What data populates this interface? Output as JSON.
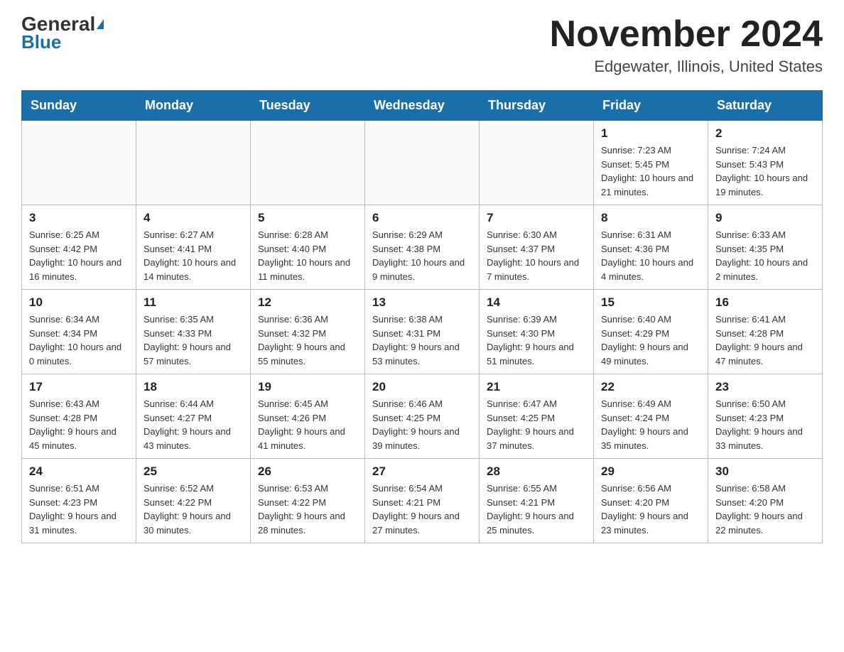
{
  "header": {
    "logo_general": "General",
    "logo_blue": "Blue",
    "month_title": "November 2024",
    "location": "Edgewater, Illinois, United States"
  },
  "days_of_week": [
    "Sunday",
    "Monday",
    "Tuesday",
    "Wednesday",
    "Thursday",
    "Friday",
    "Saturday"
  ],
  "weeks": [
    [
      {
        "day": "",
        "info": ""
      },
      {
        "day": "",
        "info": ""
      },
      {
        "day": "",
        "info": ""
      },
      {
        "day": "",
        "info": ""
      },
      {
        "day": "",
        "info": ""
      },
      {
        "day": "1",
        "info": "Sunrise: 7:23 AM\nSunset: 5:45 PM\nDaylight: 10 hours and 21 minutes."
      },
      {
        "day": "2",
        "info": "Sunrise: 7:24 AM\nSunset: 5:43 PM\nDaylight: 10 hours and 19 minutes."
      }
    ],
    [
      {
        "day": "3",
        "info": "Sunrise: 6:25 AM\nSunset: 4:42 PM\nDaylight: 10 hours and 16 minutes."
      },
      {
        "day": "4",
        "info": "Sunrise: 6:27 AM\nSunset: 4:41 PM\nDaylight: 10 hours and 14 minutes."
      },
      {
        "day": "5",
        "info": "Sunrise: 6:28 AM\nSunset: 4:40 PM\nDaylight: 10 hours and 11 minutes."
      },
      {
        "day": "6",
        "info": "Sunrise: 6:29 AM\nSunset: 4:38 PM\nDaylight: 10 hours and 9 minutes."
      },
      {
        "day": "7",
        "info": "Sunrise: 6:30 AM\nSunset: 4:37 PM\nDaylight: 10 hours and 7 minutes."
      },
      {
        "day": "8",
        "info": "Sunrise: 6:31 AM\nSunset: 4:36 PM\nDaylight: 10 hours and 4 minutes."
      },
      {
        "day": "9",
        "info": "Sunrise: 6:33 AM\nSunset: 4:35 PM\nDaylight: 10 hours and 2 minutes."
      }
    ],
    [
      {
        "day": "10",
        "info": "Sunrise: 6:34 AM\nSunset: 4:34 PM\nDaylight: 10 hours and 0 minutes."
      },
      {
        "day": "11",
        "info": "Sunrise: 6:35 AM\nSunset: 4:33 PM\nDaylight: 9 hours and 57 minutes."
      },
      {
        "day": "12",
        "info": "Sunrise: 6:36 AM\nSunset: 4:32 PM\nDaylight: 9 hours and 55 minutes."
      },
      {
        "day": "13",
        "info": "Sunrise: 6:38 AM\nSunset: 4:31 PM\nDaylight: 9 hours and 53 minutes."
      },
      {
        "day": "14",
        "info": "Sunrise: 6:39 AM\nSunset: 4:30 PM\nDaylight: 9 hours and 51 minutes."
      },
      {
        "day": "15",
        "info": "Sunrise: 6:40 AM\nSunset: 4:29 PM\nDaylight: 9 hours and 49 minutes."
      },
      {
        "day": "16",
        "info": "Sunrise: 6:41 AM\nSunset: 4:28 PM\nDaylight: 9 hours and 47 minutes."
      }
    ],
    [
      {
        "day": "17",
        "info": "Sunrise: 6:43 AM\nSunset: 4:28 PM\nDaylight: 9 hours and 45 minutes."
      },
      {
        "day": "18",
        "info": "Sunrise: 6:44 AM\nSunset: 4:27 PM\nDaylight: 9 hours and 43 minutes."
      },
      {
        "day": "19",
        "info": "Sunrise: 6:45 AM\nSunset: 4:26 PM\nDaylight: 9 hours and 41 minutes."
      },
      {
        "day": "20",
        "info": "Sunrise: 6:46 AM\nSunset: 4:25 PM\nDaylight: 9 hours and 39 minutes."
      },
      {
        "day": "21",
        "info": "Sunrise: 6:47 AM\nSunset: 4:25 PM\nDaylight: 9 hours and 37 minutes."
      },
      {
        "day": "22",
        "info": "Sunrise: 6:49 AM\nSunset: 4:24 PM\nDaylight: 9 hours and 35 minutes."
      },
      {
        "day": "23",
        "info": "Sunrise: 6:50 AM\nSunset: 4:23 PM\nDaylight: 9 hours and 33 minutes."
      }
    ],
    [
      {
        "day": "24",
        "info": "Sunrise: 6:51 AM\nSunset: 4:23 PM\nDaylight: 9 hours and 31 minutes."
      },
      {
        "day": "25",
        "info": "Sunrise: 6:52 AM\nSunset: 4:22 PM\nDaylight: 9 hours and 30 minutes."
      },
      {
        "day": "26",
        "info": "Sunrise: 6:53 AM\nSunset: 4:22 PM\nDaylight: 9 hours and 28 minutes."
      },
      {
        "day": "27",
        "info": "Sunrise: 6:54 AM\nSunset: 4:21 PM\nDaylight: 9 hours and 27 minutes."
      },
      {
        "day": "28",
        "info": "Sunrise: 6:55 AM\nSunset: 4:21 PM\nDaylight: 9 hours and 25 minutes."
      },
      {
        "day": "29",
        "info": "Sunrise: 6:56 AM\nSunset: 4:20 PM\nDaylight: 9 hours and 23 minutes."
      },
      {
        "day": "30",
        "info": "Sunrise: 6:58 AM\nSunset: 4:20 PM\nDaylight: 9 hours and 22 minutes."
      }
    ]
  ]
}
